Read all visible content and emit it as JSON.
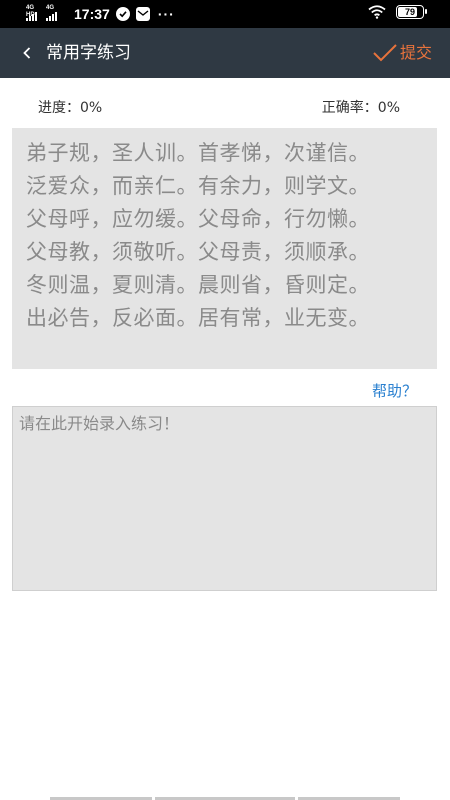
{
  "status_bar": {
    "time": "17:37",
    "network_label_1": "4G HD",
    "network_label_2": "4G",
    "more_dots": "···",
    "battery": "79",
    "battery_level": 0.79
  },
  "app_bar": {
    "title": "常用字练习",
    "submit_label": "提交"
  },
  "stats": {
    "progress_label": "进度：",
    "progress_value": "0%",
    "accuracy_label": "正确率：",
    "accuracy_value": "0%"
  },
  "passage": {
    "lines": [
      "弟子规，圣人训。首孝悌，次谨信。",
      "泛爱众，而亲仁。有余力，则学文。",
      "父母呼，应勿缓。父母命，行勿懒。",
      "父母教，须敬听。父母责，须顺承。",
      "冬则温，夏则清。晨则省，昏则定。",
      "出必告，反必面。居有常，业无变。"
    ]
  },
  "help": {
    "label": "帮助？"
  },
  "input": {
    "value": "",
    "placeholder": "请在此开始录入练习！"
  },
  "colors": {
    "app_bar_bg": "#2f3943",
    "accent_orange": "#e8733c",
    "link_blue": "#2a80d0",
    "panel_gray": "#e4e4e4"
  }
}
